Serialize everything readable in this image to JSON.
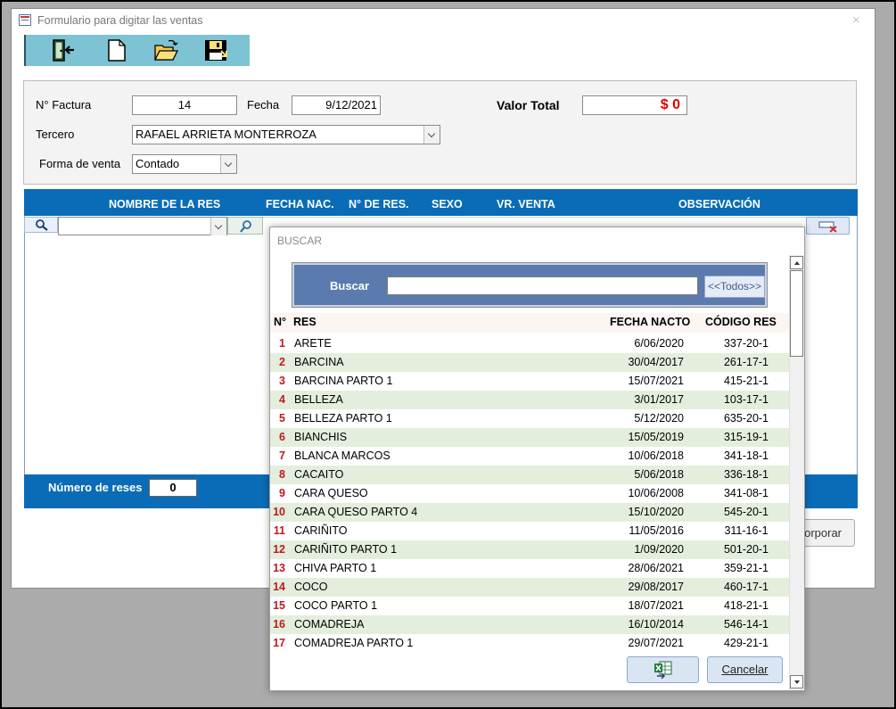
{
  "window": {
    "title": "Formulario para digitar las ventas",
    "close_glyph": "×"
  },
  "toolbar": {
    "icons": [
      "exit-door-icon",
      "new-document-icon",
      "open-folder-icon",
      "save-disk-icon"
    ]
  },
  "header": {
    "invoice_label": "N° Factura",
    "invoice_value": "14",
    "date_label": "Fecha",
    "date_value": "9/12/2021",
    "total_label": "Valor Total",
    "total_value": "$ 0",
    "third_label": "Tercero",
    "third_value": "RAFAEL ARRIETA MONTERROZA",
    "sale_type_label": "Forma de venta",
    "sale_type_value": "Contado"
  },
  "grid": {
    "columns": [
      "NOMBRE DE LA RES",
      "FECHA NAC.",
      "N° DE RES.",
      "SEXO",
      "VR. VENTA",
      "OBSERVACIÓN"
    ],
    "count_label": "Número de reses",
    "count_value": "0",
    "incorporate_label": "Incorporar"
  },
  "popup": {
    "title": "BUSCAR",
    "search_label": "Buscar",
    "search_value": "",
    "all_button": "<<Todos>>",
    "headers": {
      "no": "N°",
      "res": "RES",
      "date": "FECHA NACTO",
      "code": "CÓDIGO RES"
    },
    "rows": [
      {
        "no": "1",
        "name": "ARETE",
        "date": "6/06/2020",
        "code": "337-20-1"
      },
      {
        "no": "2",
        "name": "BARCINA",
        "date": "30/04/2017",
        "code": "261-17-1"
      },
      {
        "no": "3",
        "name": "BARCINA PARTO 1",
        "date": "15/07/2021",
        "code": "415-21-1"
      },
      {
        "no": "4",
        "name": "BELLEZA",
        "date": "3/01/2017",
        "code": "103-17-1"
      },
      {
        "no": "5",
        "name": "BELLEZA PARTO 1",
        "date": "5/12/2020",
        "code": "635-20-1"
      },
      {
        "no": "6",
        "name": "BIANCHIS",
        "date": "15/05/2019",
        "code": "315-19-1"
      },
      {
        "no": "7",
        "name": "BLANCA MARCOS",
        "date": "10/06/2018",
        "code": "341-18-1"
      },
      {
        "no": "8",
        "name": "CACAITO",
        "date": "5/06/2018",
        "code": "336-18-1"
      },
      {
        "no": "9",
        "name": "CARA QUESO",
        "date": "10/06/2008",
        "code": "341-08-1"
      },
      {
        "no": "10",
        "name": "CARA QUESO PARTO 4",
        "date": "15/10/2020",
        "code": "545-20-1"
      },
      {
        "no": "11",
        "name": "CARIÑITO",
        "date": "11/05/2016",
        "code": "311-16-1"
      },
      {
        "no": "12",
        "name": "CARIÑITO PARTO 1",
        "date": "1/09/2020",
        "code": "501-20-1"
      },
      {
        "no": "13",
        "name": "CHIVA PARTO 1",
        "date": "28/06/2021",
        "code": "359-21-1"
      },
      {
        "no": "14",
        "name": "COCO",
        "date": "29/08/2017",
        "code": "460-17-1"
      },
      {
        "no": "15",
        "name": "COCO PARTO 1",
        "date": "18/07/2021",
        "code": "418-21-1"
      },
      {
        "no": "16",
        "name": "COMADREJA",
        "date": "16/10/2014",
        "code": "546-14-1"
      },
      {
        "no": "17",
        "name": "COMADREJA PARTO 1",
        "date": "29/07/2021",
        "code": "429-21-1"
      }
    ],
    "cancel_label": "Cancelar"
  }
}
